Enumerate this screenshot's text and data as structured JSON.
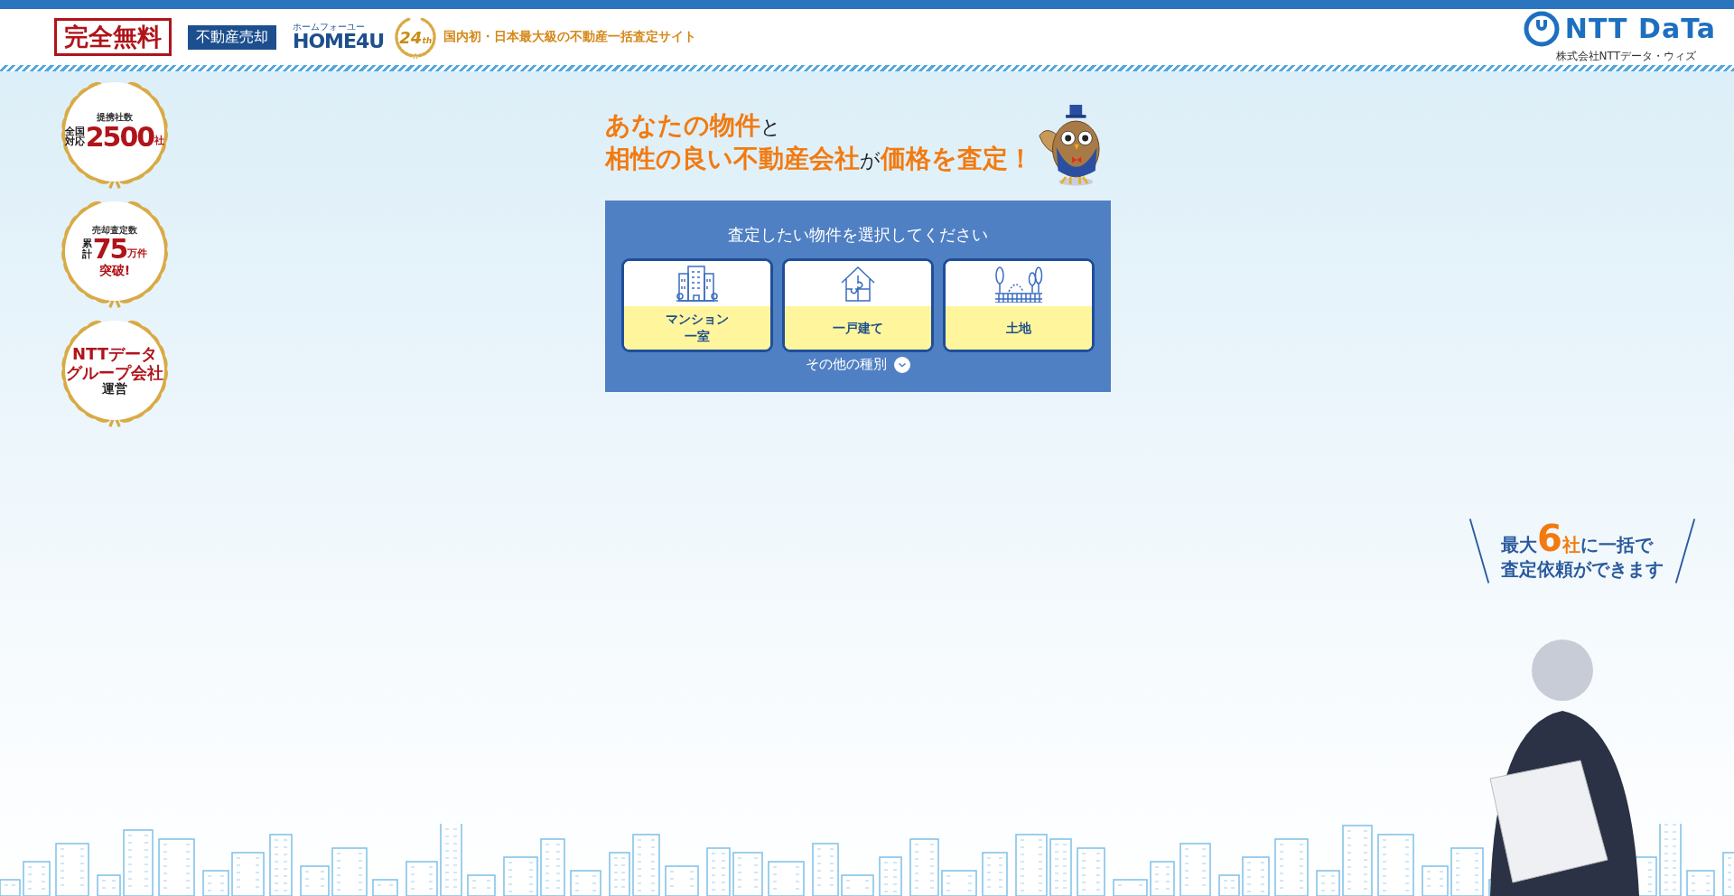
{
  "header": {
    "free_badge": "完全無料",
    "service_tag": "不動産売却",
    "logo_ruby": "ホームフォーユー",
    "logo": "HOME4U",
    "anniversary": "24",
    "anniversary_suffix": "th",
    "tagline": "国内初・日本最大級の不動産一括査定サイト",
    "company_logo": "NTT DaTa",
    "company_name": "株式会社NTTデータ・ウィズ"
  },
  "badges": [
    {
      "kind": "count",
      "caption": "提携社数",
      "side": [
        "全国",
        "対応"
      ],
      "number": "2500",
      "unit": "社"
    },
    {
      "kind": "count",
      "caption": "売却査定数",
      "side": [
        "累",
        "計"
      ],
      "number": "75",
      "unit": "万件",
      "footer": "突破!"
    },
    {
      "kind": "text",
      "lines": [
        "NTTデータ",
        "グループ会社"
      ],
      "footer": "運営"
    }
  ],
  "headline": [
    [
      {
        "text": "あなたの物件",
        "emphasis": true
      },
      {
        "text": "と",
        "emphasis": false
      }
    ],
    [
      {
        "text": "相性の良い不動産会社",
        "emphasis": true
      },
      {
        "text": "が",
        "emphasis": false
      },
      {
        "text": "価格を査定！",
        "emphasis": true
      }
    ]
  ],
  "selector": {
    "title": "査定したい物件を選択してください",
    "options": [
      {
        "kind": "building",
        "label_lines": [
          "マンション",
          "一室"
        ]
      },
      {
        "kind": "house",
        "label_lines": [
          "一戸建て"
        ]
      },
      {
        "kind": "land",
        "label_lines": [
          "土地"
        ]
      }
    ],
    "more": "その他の種別"
  },
  "promo": [
    [
      {
        "text": "最大",
        "kind": "plain"
      },
      {
        "text": "6",
        "kind": "number"
      },
      {
        "text": "社",
        "kind": "unit"
      },
      {
        "text": "に一括で",
        "kind": "plain"
      }
    ],
    [
      {
        "text": "査定依頼ができます",
        "kind": "plain"
      }
    ]
  ]
}
